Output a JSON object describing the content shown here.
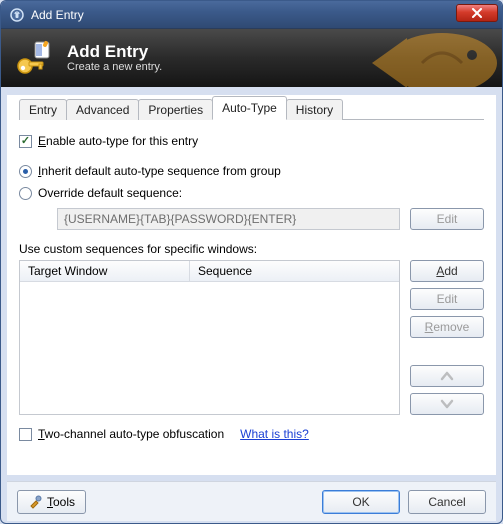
{
  "window": {
    "title": "Add Entry"
  },
  "header": {
    "title": "Add Entry",
    "subtitle": "Create a new entry."
  },
  "tabs": {
    "entry": "Entry",
    "advanced": "Advanced",
    "properties": "Properties",
    "autotype": "Auto-Type",
    "history": "History",
    "active": "autotype"
  },
  "autotype": {
    "enable_prefix": "E",
    "enable_rest": "nable auto-type for this entry",
    "inherit_prefix": "I",
    "inherit_rest": "nherit default auto-type sequence from group",
    "override_label": "Override default sequence:",
    "sequence_value": "{USERNAME}{TAB}{PASSWORD}{ENTER}",
    "edit_seq_btn": "Edit",
    "custom_label": "Use custom sequences for specific windows:",
    "col_target": "Target Window",
    "col_sequence": "Sequence",
    "add_btn_prefix": "A",
    "add_btn_rest": "dd",
    "edit_btn": "Edit",
    "remove_btn_prefix": "R",
    "remove_btn_rest": "emove",
    "two_channel_prefix": "T",
    "two_channel_rest": "wo-channel auto-type obfuscation",
    "what_is_this": "What is this?"
  },
  "footer": {
    "tools_prefix": "T",
    "tools_rest": "ools",
    "ok": "OK",
    "cancel": "Cancel"
  }
}
